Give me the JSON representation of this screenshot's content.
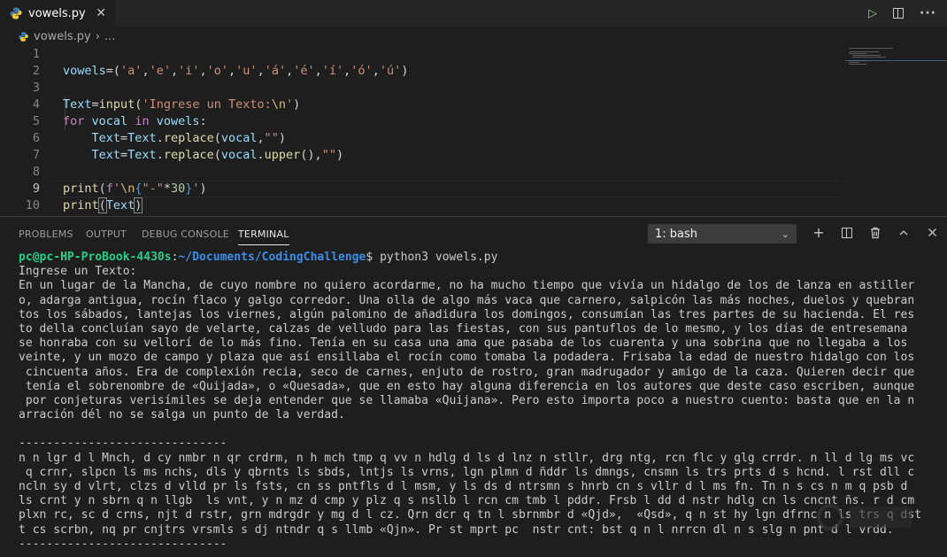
{
  "tab": {
    "filename": "vowels.py"
  },
  "breadcrumb": {
    "file": "vowels.py",
    "separator": "›",
    "ellipsis": "..."
  },
  "editor": {
    "line_numbers": [
      "1",
      "2",
      "3",
      "4",
      "5",
      "6",
      "7",
      "8",
      "9",
      "10"
    ],
    "lines": [
      "vowels=('a','e','i','o','u','á','é','í','ó','ú')",
      "",
      "Text=input('Ingrese un Texto:\\n')",
      "for vocal in vowels:",
      "    Text=Text.replace(vocal,\"\")",
      "    Text=Text.replace(vocal.upper(),\"\")",
      "",
      "print(f'\\n{\"-\"*30}')",
      "print(Text)",
      "print(f'{\"-\"*30}\\n')"
    ]
  },
  "panel": {
    "tabs": [
      "PROBLEMS",
      "OUTPUT",
      "DEBUG CONSOLE",
      "TERMINAL"
    ],
    "active_tab": "TERMINAL",
    "terminal_selector": "1: bash"
  },
  "terminal": {
    "prompt_user": "pc@pc-HP-ProBook-4430s",
    "prompt_sep": ":",
    "prompt_path": "~/Documents/CodingChallenge",
    "command": "$ python3 vowels.py",
    "output_lines": [
      "Ingrese un Texto:",
      "En un lugar de la Mancha, de cuyo nombre no quiero acordarme, no ha mucho tiempo que vivía un hidalgo de los de lanza en astiller",
      "o, adarga antigua, rocín flaco y galgo corredor. Una olla de algo más vaca que carnero, salpicón las más noches, duelos y quebran",
      "tos los sábados, lantejas los viernes, algún palomino de añadidura los domingos, consumían las tres partes de su hacienda. El res",
      "to della concluían sayo de velarte, calzas de velludo para las fiestas, con sus pantuflos de lo mesmo, y los días de entresemana",
      "se honraba con su vellorí de lo más fino. Tenía en su casa una ama que pasaba de los cuarenta y una sobrina que no llegaba a los",
      "veinte, y un mozo de campo y plaza que así ensillaba el rocín como tomaba la podadera. Frisaba la edad de nuestro hidalgo con los",
      " cincuenta años. Era de complexión recia, seco de carnes, enjuto de rostro, gran madrugador y amigo de la caza. Quieren decir que",
      " tenía el sobrenombre de «Quijada», o «Quesada», que en esto hay alguna diferencia en los autores que deste caso escriben, aunque",
      " por conjeturas verisímiles se deja entender que se llamaba «Quijana». Pero esto importa poco a nuestro cuento: basta que en la n",
      "arración dél no se salga un punto de la verdad.",
      "",
      "------------------------------",
      "n n lgr d l Mnch, d cy nmbr n qr crdrm, n h mch tmp q vv n hdlg d ls d lnz n stllr, drg ntg, rcn flc y glg crrdr. n ll d lg ms vc",
      " q crnr, slpcn ls ms nchs, dls y qbrnts ls sbds, lntjs ls vrns, lgn plmn d ñddr ls dmngs, cnsmn ls trs prts d s hcnd. l rst dll c",
      "ncln sy d vlrt, clzs d vlld pr ls fsts, cn ss pntfls d l msm, y ls ds d ntrsmn s hnrb cn s vllr d l ms fn. Tn n s cs n m q psb d",
      "ls crnt y n sbrn q n llgb  ls vnt, y n mz d cmp y plz q s nsllb l rcn cm tmb l pddr. Frsb l dd d nstr hdlg cn ls cncnt ñs. r d cm",
      "plxn rc, sc d crns, njt d rstr, grn mdrgdr y mg d l cz. Qrn dcr q tn l sbrnmbr d «Qjd»,  «Qsd», q n st hy lgn dfrnc n ls trs q dst",
      "t cs scrbn, nq pr cnjtrs vrsmls s dj ntndr q s llmb «Qjn». Pr st mprt pc  nstr cnt: bst q n l nrrcn dl n s slg n pnt d l vrdd.",
      "------------------------------"
    ]
  }
}
